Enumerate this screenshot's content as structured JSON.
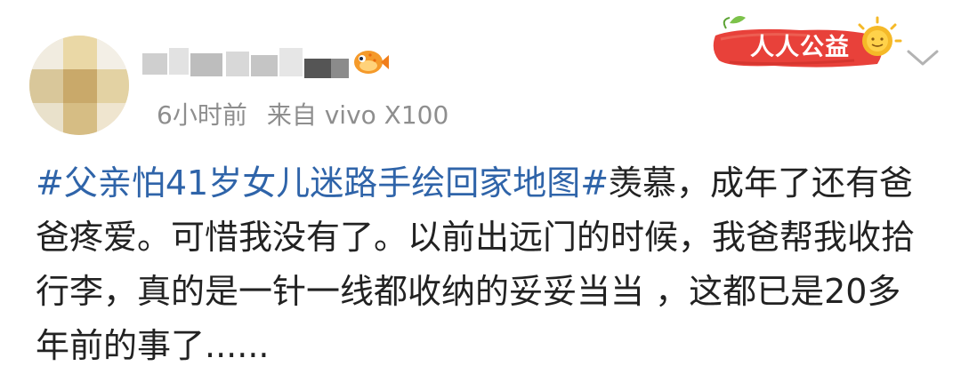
{
  "header": {
    "timestamp": "6小时前",
    "source": "来自 vivo X100",
    "charity_badge_label": "人人公益",
    "badge_icon": "puffer-fish-icon",
    "menu_icon": "chevron-down-icon"
  },
  "post": {
    "hashtag": "#父亲怕41岁女儿迷路手绘回家地图#",
    "text": "羡慕，成年了还有爸爸疼爱。可惜我没有了。以前出远门的时候，我爸帮我收拾行李，真的是一针一线都收纳的妥妥当当 ，这都已是20多年前的事了......"
  },
  "colors": {
    "hashtag": "#2f64a9",
    "body_text": "#222222",
    "meta_text": "#8e8e8e",
    "badge_red": "#e8413a",
    "badge_sun": "#f5b928"
  }
}
